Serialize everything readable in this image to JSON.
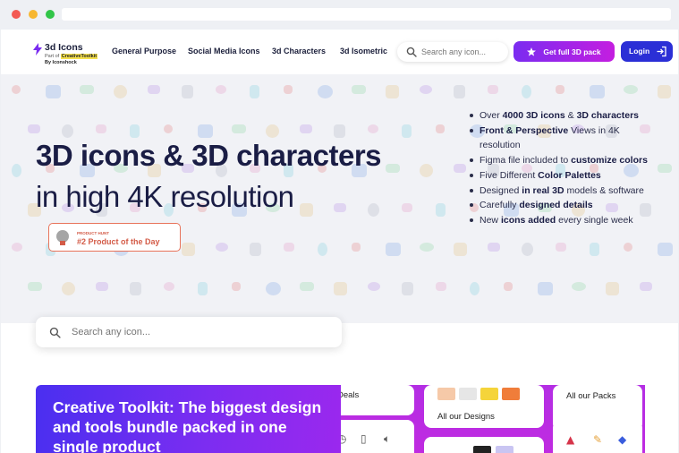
{
  "window": {
    "controls": [
      "close",
      "minimize",
      "maximize"
    ]
  },
  "logo": {
    "icon": "bolt-icon",
    "title": "3d Icons",
    "part_of_prefix": "Part of ",
    "part_of_brand": "CreativeToolkit",
    "by": "By Iconshock"
  },
  "nav": {
    "items": [
      "General Purpose",
      "Social Media Icons",
      "3d Characters",
      "3d Isometric"
    ]
  },
  "header": {
    "search_placeholder": "Search any icon...",
    "cta_label": "Get full 3D pack",
    "cta_icon": "star-icon",
    "login_label": "Login",
    "login_icon": "login-arrow-icon"
  },
  "hero": {
    "title_line1": "3D icons & 3D characters",
    "title_line2": "in high 4K resolution",
    "badge_small": "PRODUCT HUNT",
    "badge_big": "#2 Product of the Day",
    "features": [
      {
        "pre": "Over ",
        "bold": "4000 3D icons",
        "post": " & ",
        "bold2": "3D characters"
      },
      {
        "pre": "",
        "bold": "Front & Perspective",
        "post": " Views in 4K resolution",
        "bold2": ""
      },
      {
        "pre": "Figma file included to ",
        "bold": "customize colors",
        "post": "",
        "bold2": ""
      },
      {
        "pre": "Five Different ",
        "bold": "Color Palettes",
        "post": "",
        "bold2": ""
      },
      {
        "pre": "Designed ",
        "bold": "in real 3D",
        "post": " models & software",
        "bold2": ""
      },
      {
        "pre": "Carefully ",
        "bold": "designed details",
        "post": "",
        "bold2": ""
      },
      {
        "pre": "New ",
        "bold": "icons added",
        "post": " every single week",
        "bold2": ""
      }
    ]
  },
  "search": {
    "placeholder": "Search any icon..."
  },
  "promo": {
    "heading": "Creative Toolkit: The biggest design and tools bundle packed in one single product",
    "tiles": {
      "deals": "Deals",
      "designs": "All our Designs",
      "packs": "All our Packs"
    }
  },
  "colors": {
    "brand_dark": "#1a1d45",
    "cta_gradient_start": "#7a2cf0",
    "cta_gradient_end": "#c41ee0",
    "login_blue": "#2b2fd6",
    "badge_red": "#d35b47",
    "promo_purple": "#7b2df1"
  }
}
